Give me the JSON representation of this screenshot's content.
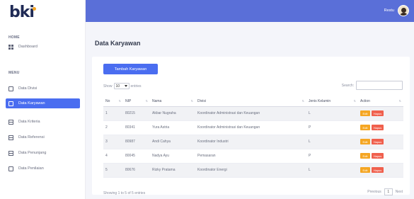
{
  "brand": {
    "name": "bki"
  },
  "topbar": {
    "user_name": "Restu"
  },
  "sidebar": {
    "sections": [
      {
        "label": "HOME",
        "items": [
          {
            "label": "Dashboard",
            "icon": "grid-icon"
          }
        ]
      },
      {
        "label": "MENU",
        "items": [
          {
            "label": "Data Divisi",
            "icon": "box-icon"
          },
          {
            "label": "Data Karyawan",
            "icon": "box-icon",
            "active": true
          },
          {
            "label": "Data Kriteria",
            "icon": "table-icon"
          },
          {
            "label": "Data Referensi",
            "icon": "table-icon"
          },
          {
            "label": "Data Penunjang",
            "icon": "table-icon"
          },
          {
            "label": "Data Penilaian",
            "icon": "document-icon"
          }
        ]
      }
    ]
  },
  "main": {
    "title": "Data Karyawan",
    "add_button": "Tambah Karyawan",
    "show_label": "Show",
    "show_value": "10",
    "entries_label": "entries",
    "search_label": "Search:",
    "search_value": "",
    "table": {
      "headers": [
        "No",
        "NIP",
        "Nama",
        "Divisi",
        "Jenis Kelamin",
        "Action"
      ],
      "rows": [
        [
          "1",
          "80215",
          "Akbar Nugraha",
          "Koordinator Administrasi dan Keuangan",
          "L"
        ],
        [
          "2",
          "80341",
          "Yura Astria",
          "Koordinator Administrasi dan Keuangan",
          "P"
        ],
        [
          "3",
          "80987",
          "Andi Cahya",
          "Koordinator Industri",
          "L"
        ],
        [
          "4",
          "80045",
          "Nadya Ayu",
          "Pemasaran",
          "P"
        ],
        [
          "5",
          "80676",
          "Rizky Pratama",
          "Koordinator Energi",
          "L"
        ]
      ],
      "edit_label": "Edit",
      "delete_label": "Hapus"
    },
    "info": "Showing 1 to 5 of 5 entries",
    "pagination": {
      "previous": "Previous",
      "current": "1",
      "next": "Next"
    }
  },
  "colors": {
    "primary": "#4a6df0",
    "topbar": "#5a6fd8",
    "edit": "#f5a623",
    "delete": "#f0604d"
  }
}
